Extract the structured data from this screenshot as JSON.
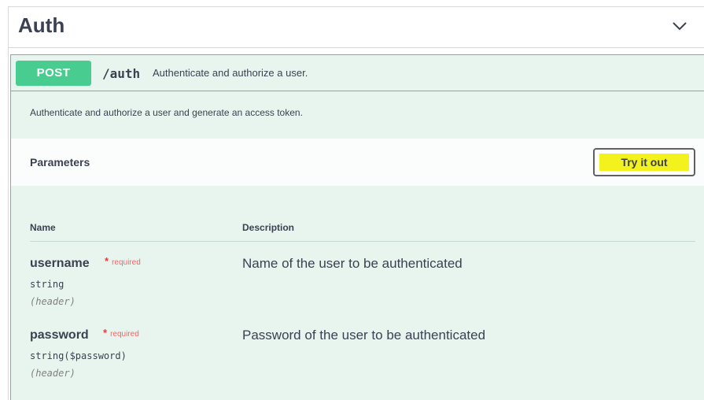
{
  "tag": {
    "title": "Auth",
    "chevron_icon": "chevron-down-icon"
  },
  "operation": {
    "method": "POST",
    "path": "/auth",
    "summary": "Authenticate and authorize a user.",
    "description": "Authenticate and authorize a user and generate an access token.",
    "colors": {
      "method": "#49cc90",
      "background": "#e8f5ef"
    }
  },
  "parameters": {
    "title": "Parameters",
    "try_button_label": "Try it out",
    "columns": {
      "name": "Name",
      "description": "Description"
    },
    "items": [
      {
        "name": "username",
        "required_label": "required",
        "type": "string",
        "in": "(header)",
        "description": "Name of the user to be authenticated"
      },
      {
        "name": "password",
        "required_label": "required",
        "type": "string($password)",
        "in": "(header)",
        "description": "Password of the user to be authenticated"
      }
    ]
  }
}
